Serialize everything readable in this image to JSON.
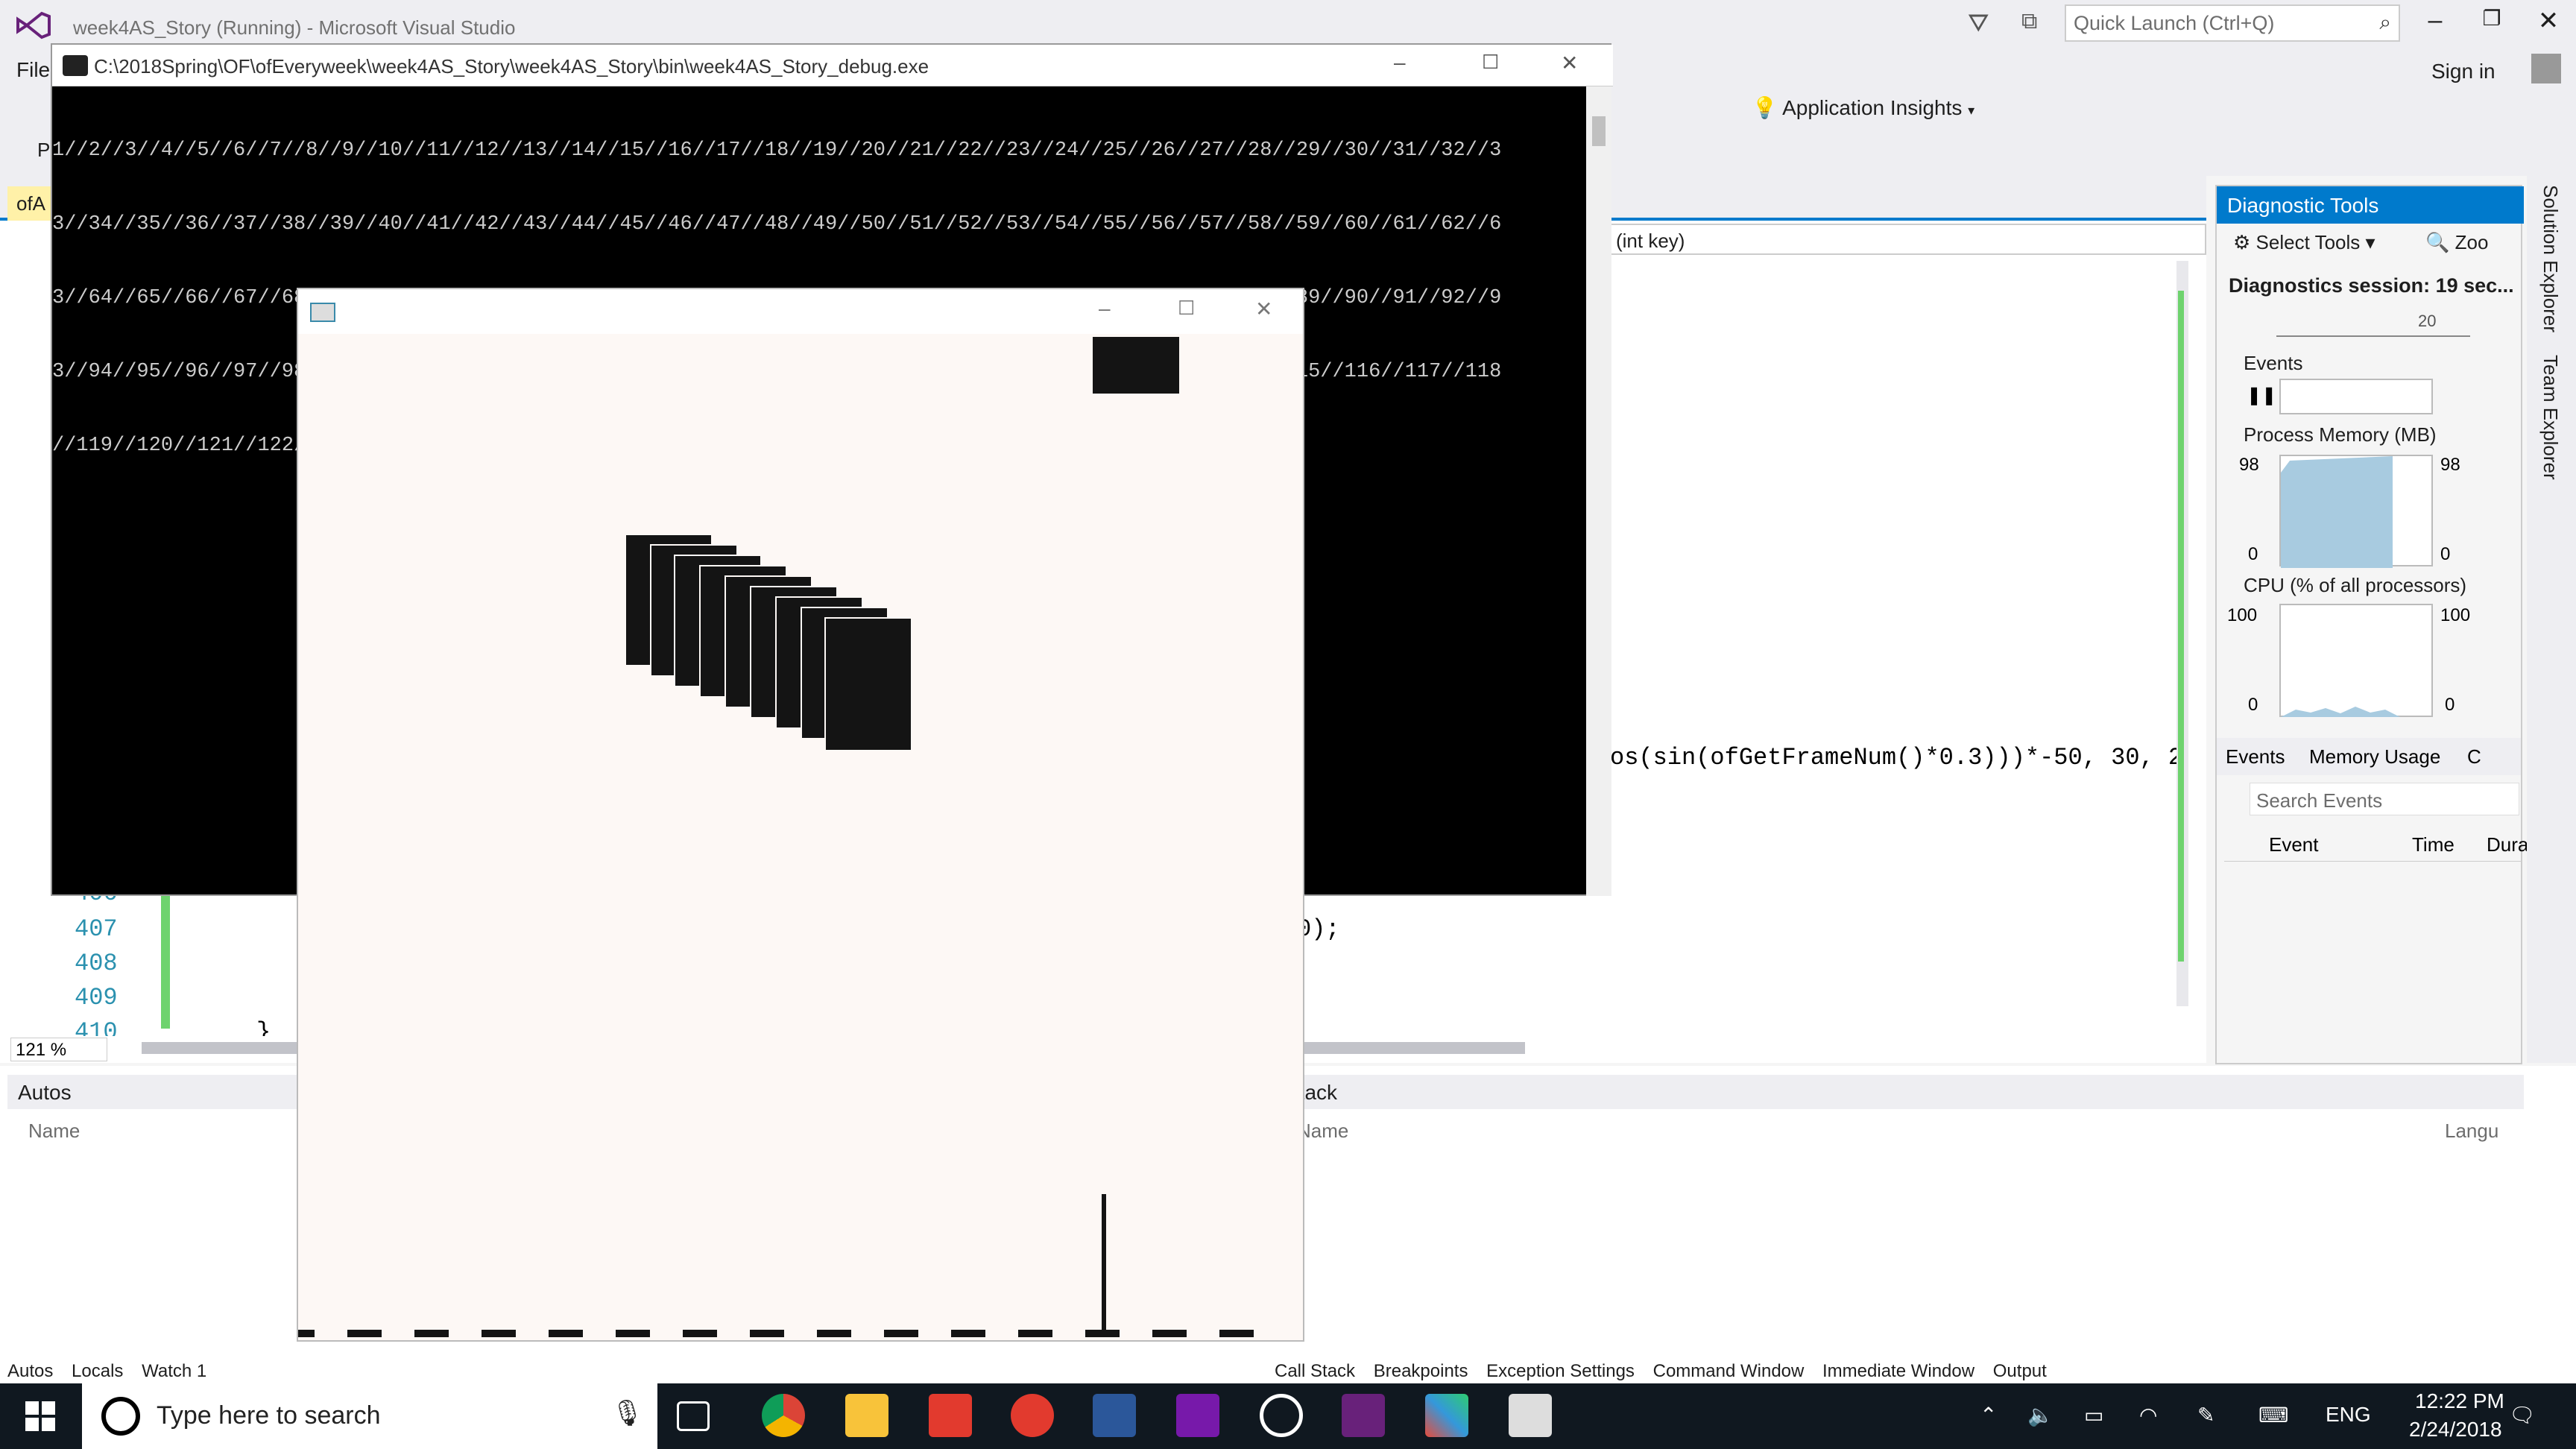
{
  "vs": {
    "title": "week4AS_Story (Running) - Microsoft Visual Studio",
    "menu_file": "File",
    "menu_p": "P",
    "quick_launch": "Quick Launch (Ctrl+Q)",
    "sign_in": "Sign in",
    "app_insights": "Application Insights",
    "doc_tab": "ofA",
    "nav_dropdown": "(int key)",
    "code_line_sin": "os(sin(ofGetFrameNum()*0.3)))*-50, 30, 2",
    "code_line_end": "0);",
    "code_brace": "}",
    "line_numbers": [
      "406",
      "407",
      "408",
      "409",
      "410"
    ],
    "zoom": "121 %"
  },
  "diagnostics": {
    "title": "Diagnostic Tools",
    "select_tools": "Select Tools",
    "zoom": "Zoo",
    "session": "Diagnostics session: 19 sec...",
    "timeline_tick": "20",
    "events": "Events",
    "process_memory": "Process Memory (MB)",
    "mem_max": "98",
    "mem_min": "0",
    "cpu": "CPU (% of all processors)",
    "cpu_max": "100",
    "cpu_min": "0",
    "tab_events": "Events",
    "tab_memory": "Memory Usage",
    "tab_c": "C",
    "search_events": "Search Events",
    "col_event": "Event",
    "col_time": "Time",
    "col_dura": "Dura"
  },
  "side_tabs": {
    "solution": "Solution Explorer",
    "team": "Team Explorer"
  },
  "autos": {
    "title": "Autos",
    "col_name": "Name",
    "tabs": [
      "Autos",
      "Locals",
      "Watch 1"
    ]
  },
  "callstack": {
    "title": "Stack",
    "col_name": "Name",
    "col_lang": "Langu",
    "tabs": [
      "Call Stack",
      "Breakpoints",
      "Exception Settings",
      "Command Window",
      "Immediate Window",
      "Output"
    ]
  },
  "console": {
    "path": "C:\\2018Spring\\OF\\ofEveryweek\\week4AS_Story\\week4AS_Story\\bin\\week4AS_Story_debug.exe",
    "lines": [
      "1//2//3//4//5//6//7//8//9//10//11//12//13//14//15//16//17//18//19//20//21//22//23//24//25//26//27//28//29//30//31//32//3",
      "3//34//35//36//37//38//39//40//41//42//43//44//45//46//47//48//49//50//51//52//53//54//55//56//57//58//59//60//61//62//6",
      "3//64//65//66//67//68//69//70//71//72//73//74//75//76//77//78//79//80//81//82//83//84//85//86//87//88//89//90//91//92//9",
      "3//94//95//96//97//98//99//100//101//102//103//104//105//106//107//108//109//110//111//112//113//114//115//116//117//118",
      "//119//120//121//122//123//124//125//126//127/"
    ]
  },
  "taskbar": {
    "search": "Type here to search",
    "lang": "ENG",
    "time": "12:22 PM",
    "date": "2/24/2018"
  }
}
